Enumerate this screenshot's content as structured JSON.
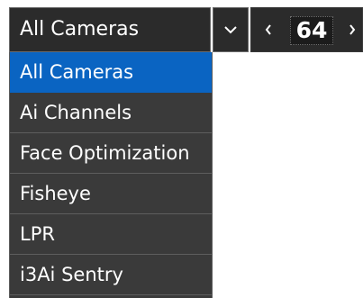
{
  "camera_select": {
    "value": "All Cameras",
    "options": [
      "All Cameras",
      "Ai Channels",
      "Face Optimization",
      "Fisheye",
      "LPR",
      "i3Ai Sentry"
    ],
    "selected_index": 0
  },
  "pager": {
    "count": "64"
  },
  "colors": {
    "selected": "#0a64c2",
    "panel": "#3a3a3a",
    "control": "#2b2b2b"
  },
  "icons": {
    "toggle": "chevron-down-icon",
    "prev": "chevron-left-icon",
    "next": "chevron-right-icon"
  }
}
